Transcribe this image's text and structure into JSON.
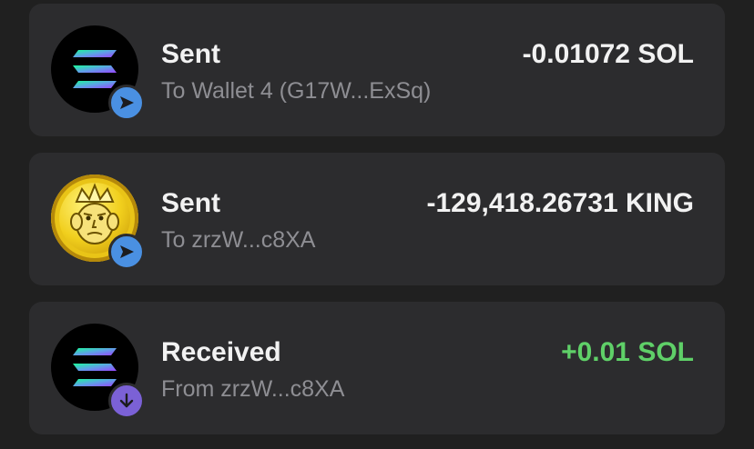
{
  "colors": {
    "background": "#202020",
    "card": "#2c2c2e",
    "title_text": "#f2f2f2",
    "secondary_text": "#8e8e93",
    "positive_amount": "#5fd068",
    "send_badge": "#4a90e2",
    "receive_badge": "#7b61d6"
  },
  "transactions": [
    {
      "type": "Sent",
      "counterparty": "To Wallet 4 (G17W...ExSq)",
      "amount": "-0.01072 SOL",
      "token_icon": "solana-logo-icon",
      "badge_icon": "send-arrow-icon"
    },
    {
      "type": "Sent",
      "counterparty": "To zrzW...c8XA",
      "amount": "-129,418.26731 KING",
      "token_icon": "king-coin-icon",
      "badge_icon": "send-arrow-icon"
    },
    {
      "type": "Received",
      "counterparty": "From zrzW...c8XA",
      "amount": "+0.01 SOL",
      "token_icon": "solana-logo-icon",
      "badge_icon": "receive-arrow-icon"
    }
  ]
}
